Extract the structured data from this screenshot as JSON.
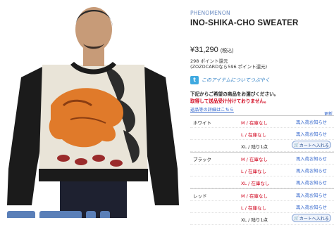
{
  "product": {
    "brand": "PHENOMENON",
    "name": "INO-SHIKA-CHO SWEATER",
    "price": "¥31,290",
    "tax_label": "(税込)",
    "points": "298 ポイント還元",
    "zozocard_points": "(ZOZOCARDなら596 ポイント還元)"
  },
  "social": {
    "tweet_icon": "twitter-icon",
    "tweet_text": "このアイテムについてつぶやく"
  },
  "instructions": {
    "line1": "下記からご希望の商品をお選びください。",
    "line2": "取得して送品受け付けておりません。",
    "line3": "返品等の詳細はこちら",
    "more": "更新"
  },
  "colors": [
    {
      "name": "ホワイト",
      "sizes": [
        {
          "size": "M / 在庫なし",
          "status": "none",
          "action": "再入荷お知らせ"
        },
        {
          "size": "L / 在庫なし",
          "status": "none",
          "action": "再入荷お知らせ"
        },
        {
          "size": "XL / 残り1点",
          "status": "left",
          "action": "カートへ入れる"
        }
      ]
    },
    {
      "name": "ブラック",
      "sizes": [
        {
          "size": "M / 在庫なし",
          "status": "none",
          "action": "再入荷お知らせ"
        },
        {
          "size": "L / 在庫なし",
          "status": "none",
          "action": "再入荷お知らせ"
        },
        {
          "size": "XL / 在庫なし",
          "status": "none",
          "action": "再入荷お知らせ"
        }
      ]
    },
    {
      "name": "レッド",
      "sizes": [
        {
          "size": "M / 在庫なし",
          "status": "none",
          "action": "再入荷お知らせ"
        },
        {
          "size": "L / 在庫なし",
          "status": "none",
          "action": "再入荷お知らせ"
        },
        {
          "size": "XL / 残り1点",
          "status": "left",
          "action": "カートへ入れる"
        }
      ]
    }
  ],
  "theme": {
    "sale_red": "#d0021b",
    "link_blue": "#3366cc",
    "brand_blue": "#6b8cc2"
  }
}
